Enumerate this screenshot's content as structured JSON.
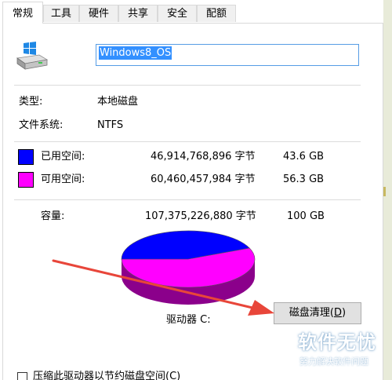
{
  "tabs": [
    "常规",
    "工具",
    "硬件",
    "共享",
    "安全",
    "配额"
  ],
  "active_tab": "常规",
  "drive_name": "Windows8_OS",
  "type_label": "类型:",
  "type_value": "本地磁盘",
  "fs_label": "文件系统:",
  "fs_value": "NTFS",
  "used": {
    "label": "已用空间:",
    "bytes": "46,914,768,896 字节",
    "size": "43.6 GB",
    "color": "#0000ff"
  },
  "free": {
    "label": "可用空间:",
    "bytes": "60,460,457,984 字节",
    "size": "56.3 GB",
    "color": "#ff00ff"
  },
  "capacity": {
    "label": "容量:",
    "bytes": "107,375,226,880 字节",
    "size": "100 GB"
  },
  "pie": {
    "used_fraction": 0.436,
    "used_color": "#0000ff",
    "free_color": "#ff00ff"
  },
  "drive_label": "驱动器 C:",
  "cleanup_button": {
    "text_before": "磁盘清理(",
    "accel": "D",
    "text_after": ")"
  },
  "compress_checkbox": "压缩此驱动器以节约磁盘空间(C)",
  "watermark": {
    "title": "软件无忧",
    "subtitle": "努力解决软件问题"
  },
  "annotation_arrow_color": "#e8463a"
}
